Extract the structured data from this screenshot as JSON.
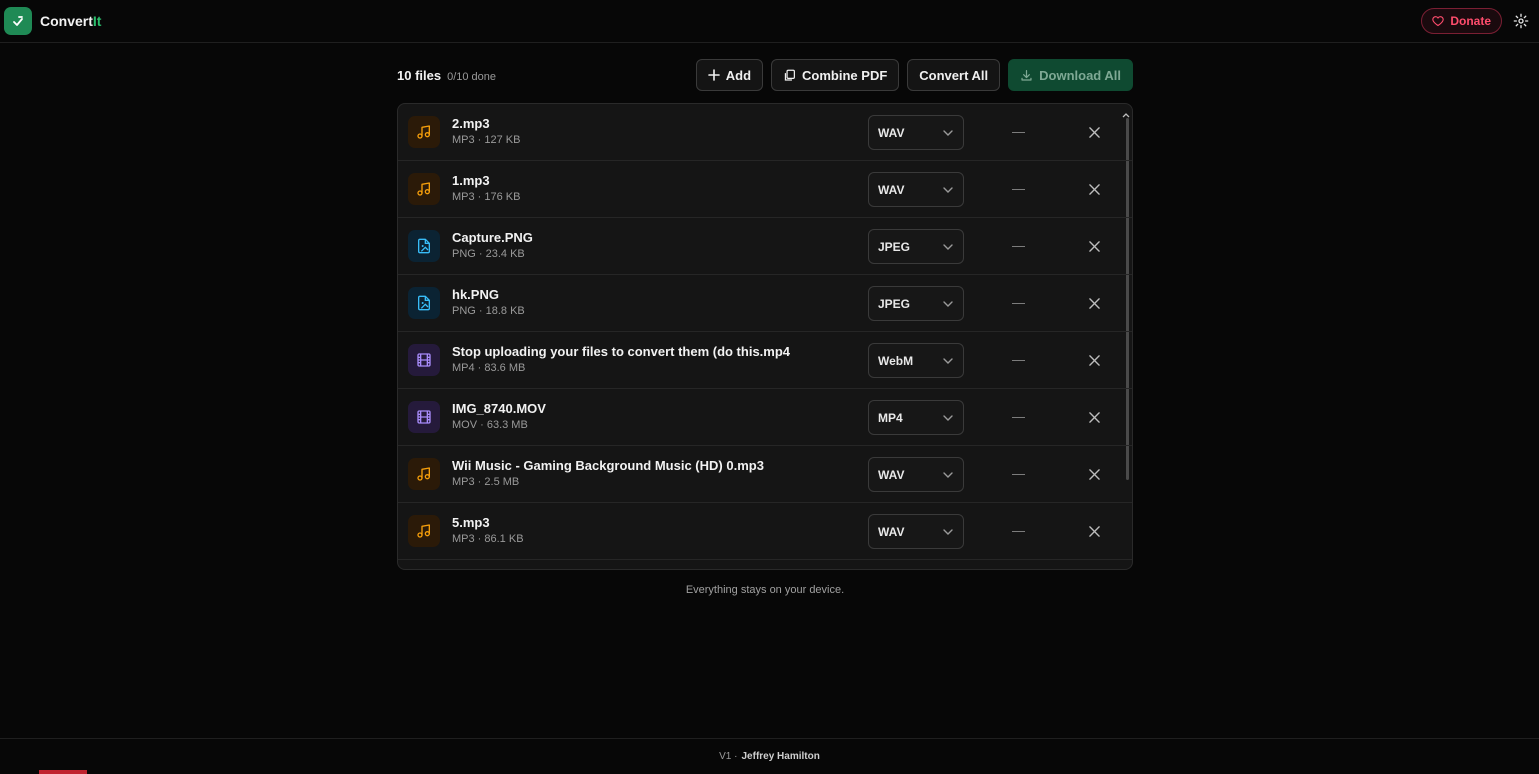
{
  "app": {
    "name_main": "Convert",
    "name_accent": "It",
    "donate_label": "Donate"
  },
  "toolbar": {
    "file_count": "10 files",
    "progress": "0/10 done",
    "add_label": "Add",
    "combine_label": "Combine PDF",
    "convert_label": "Convert All",
    "download_label": "Download All"
  },
  "files": [
    {
      "name": "2.mp3",
      "meta": "MP3 · 127 KB",
      "format": "WAV",
      "status": "—",
      "kind": "audio"
    },
    {
      "name": "1.mp3",
      "meta": "MP3 · 176 KB",
      "format": "WAV",
      "status": "—",
      "kind": "audio"
    },
    {
      "name": "Capture.PNG",
      "meta": "PNG · 23.4 KB",
      "format": "JPEG",
      "status": "—",
      "kind": "image"
    },
    {
      "name": "hk.PNG",
      "meta": "PNG · 18.8 KB",
      "format": "JPEG",
      "status": "—",
      "kind": "image"
    },
    {
      "name": "Stop uploading your files to convert them (do this.mp4",
      "meta": "MP4 · 83.6 MB",
      "format": "WebM",
      "status": "—",
      "kind": "video"
    },
    {
      "name": "IMG_8740.MOV",
      "meta": "MOV · 63.3 MB",
      "format": "MP4",
      "status": "—",
      "kind": "video"
    },
    {
      "name": "Wii Music - Gaming Background Music (HD) 0.mp3",
      "meta": "MP3 · 2.5 MB",
      "format": "WAV",
      "status": "—",
      "kind": "audio"
    },
    {
      "name": "5.mp3",
      "meta": "MP3 · 86.1 KB",
      "format": "WAV",
      "status": "—",
      "kind": "audio"
    }
  ],
  "note": "Everything stays on your device.",
  "footer": {
    "version": "V1 ·",
    "author": "Jeffrey Hamilton"
  },
  "colors": {
    "brand_green": "#1f8a55",
    "donate_red": "#ff4d6d",
    "audio_icon": "#f59e0b",
    "image_icon": "#38bdf8",
    "video_icon": "#a78bfa"
  }
}
